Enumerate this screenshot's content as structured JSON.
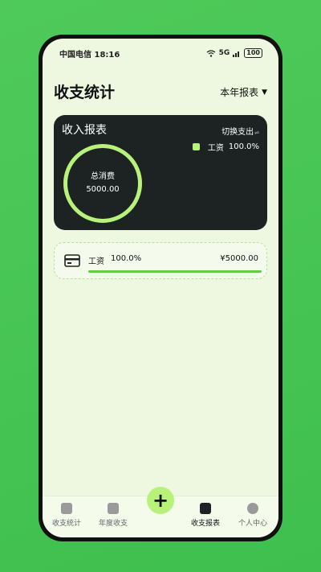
{
  "status_bar": {
    "carrier_time": "中国电信 18:16",
    "network": "5G",
    "battery": "100"
  },
  "header": {
    "title": "收支统计",
    "period": "本年报表"
  },
  "report_card": {
    "title": "收入报表",
    "switch_label": "切换支出",
    "legend": [
      {
        "name": "工资",
        "percent": "100.0%"
      }
    ],
    "center_label": "总消费",
    "center_value": "5000.00"
  },
  "items": [
    {
      "name": "工资",
      "percent": "100.0%",
      "amount": "¥5000.00",
      "share": 1.0
    }
  ],
  "tabbar": {
    "tabs": [
      {
        "label": "收支统计",
        "icon": "ledger-icon"
      },
      {
        "label": "年度收支",
        "icon": "wallet-icon"
      },
      {
        "label": "收支报表",
        "icon": "report-icon"
      },
      {
        "label": "个人中心",
        "icon": "user-icon"
      }
    ],
    "fab": "+"
  },
  "colors": {
    "accent": "#b9f27b",
    "card_bg": "#1c2322",
    "bar": "#62cb47",
    "page_bg": "#eef8e1"
  }
}
